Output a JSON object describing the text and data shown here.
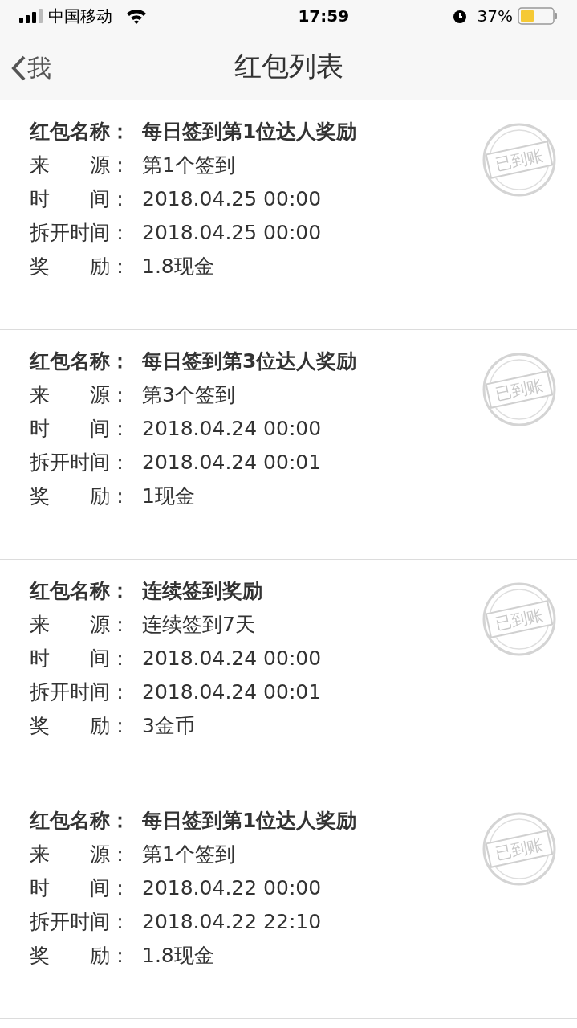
{
  "status_bar": {
    "carrier": "中国移动",
    "time": "17:59",
    "battery": "37%"
  },
  "nav_bar": {
    "back": "我",
    "title": "红包列表"
  },
  "records": [
    {
      "stamp": "已到账",
      "fields": [
        {
          "label": "红包名称：",
          "value": "每日签到第1位达人奖励",
          "kind": "title"
        },
        {
          "label": "来　　源：",
          "value": "第1个签到",
          "kind": "plain"
        },
        {
          "label": "时　　间：",
          "value": "2018.04.25 00:00",
          "kind": "plain"
        },
        {
          "label": "拆开时间：",
          "value": "2018.04.25 00:00",
          "kind": "plain"
        },
        {
          "label": "奖　　励：",
          "value": "1.8现金",
          "kind": "plain"
        }
      ]
    },
    {
      "stamp": "已到账",
      "fields": [
        {
          "label": "红包名称：",
          "value": "每日签到第3位达人奖励",
          "kind": "title"
        },
        {
          "label": "来　　源：",
          "value": "第3个签到",
          "kind": "plain"
        },
        {
          "label": "时　　间：",
          "value": "2018.04.24 00:00",
          "kind": "plain"
        },
        {
          "label": "拆开时间：",
          "value": "2018.04.24 00:01",
          "kind": "plain"
        },
        {
          "label": "奖　　励：",
          "value": "1现金",
          "kind": "plain"
        }
      ]
    },
    {
      "stamp": "已到账",
      "fields": [
        {
          "label": "红包名称：",
          "value": "连续签到奖励",
          "kind": "title"
        },
        {
          "label": "来　　源：",
          "value": "连续签到7天",
          "kind": "plain"
        },
        {
          "label": "时　　间：",
          "value": "2018.04.24 00:00",
          "kind": "plain"
        },
        {
          "label": "拆开时间：",
          "value": "2018.04.24 00:01",
          "kind": "plain"
        },
        {
          "label": "奖　　励：",
          "value": "3金币",
          "kind": "plain"
        }
      ]
    },
    {
      "stamp": "已到账",
      "fields": [
        {
          "label": "红包名称：",
          "value": "每日签到第1位达人奖励",
          "kind": "title"
        },
        {
          "label": "来　　源：",
          "value": "第1个签到",
          "kind": "plain"
        },
        {
          "label": "时　　间：",
          "value": "2018.04.22 00:00",
          "kind": "plain"
        },
        {
          "label": "拆开时间：",
          "value": "2018.04.22 22:10",
          "kind": "plain"
        },
        {
          "label": "奖　　励：",
          "value": "1.8现金",
          "kind": "plain"
        }
      ]
    }
  ]
}
